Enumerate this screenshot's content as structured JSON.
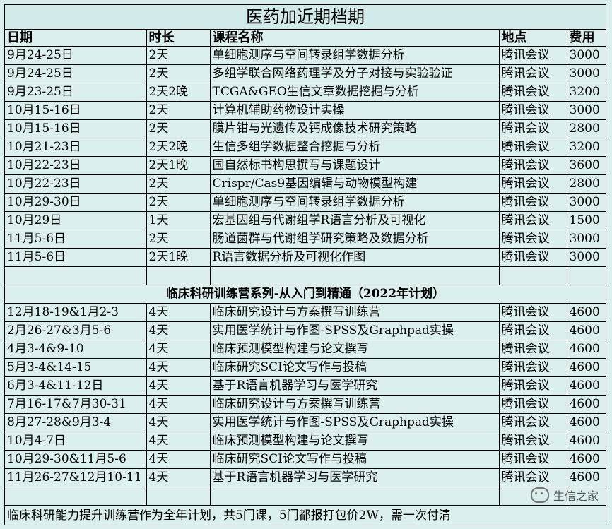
{
  "title": "医药加近期档期",
  "headers": {
    "date": "日期",
    "duration": "时长",
    "course": "课程名称",
    "location": "地点",
    "fee": "费用"
  },
  "courses": [
    {
      "date": "9月24-25日",
      "duration": "2天",
      "course": "单细胞测序与空间转录组学数据分析",
      "location": "腾讯会议",
      "fee": "3000"
    },
    {
      "date": "9月24-25日",
      "duration": "2天",
      "course": "多组学联合网络药理学及分子对接与实验验证",
      "location": "腾讯会议",
      "fee": "3000"
    },
    {
      "date": "9月23-25日",
      "duration": "2天2晚",
      "course": "TCGA&GEO生信文章数据挖掘与分析",
      "location": "腾讯会议",
      "fee": "3200"
    },
    {
      "date": "10月15-16日",
      "duration": "2天",
      "course": "计算机辅助药物设计实操",
      "location": "腾讯会议",
      "fee": "3000"
    },
    {
      "date": "10月15-16日",
      "duration": "2天",
      "course": "膜片钳与光遗传及钙成像技术研究策略",
      "location": "腾讯会议",
      "fee": "2800"
    },
    {
      "date": "10月21-23日",
      "duration": "2天2晚",
      "course": "生信多组学数据整合挖掘与分析",
      "location": "腾讯会议",
      "fee": "3200"
    },
    {
      "date": "10月22-23日",
      "duration": "2天1晚",
      "course": "国自然标书构思撰写与课题设计",
      "location": "腾讯会议",
      "fee": "3600"
    },
    {
      "date": "10月22-23日",
      "duration": "2天",
      "course": "Crispr/Cas9基因编辑与动物模型构建",
      "location": "腾讯会议",
      "fee": "2800"
    },
    {
      "date": "10月29-30日",
      "duration": "2天",
      "course": "单细胞测序与空间转录组学数据分析",
      "location": "腾讯会议",
      "fee": "3000"
    },
    {
      "date": "10月29日",
      "duration": "1天",
      "course": "宏基因组与代谢组学R语言分析及可视化",
      "location": "腾讯会议",
      "fee": "1500"
    },
    {
      "date": "11月5-6日",
      "duration": "2天",
      "course": "肠道菌群与代谢组学研究策略及数据分析",
      "location": "腾讯会议",
      "fee": "3000"
    },
    {
      "date": "11月5-6日",
      "duration": "2天1晚",
      "course": "R语言数据分析及可视化作图",
      "location": "腾讯会议",
      "fee": "3000"
    }
  ],
  "section_title": "临床科研训练营系列-从入门到精通（2022年计划）",
  "camps": [
    {
      "date": "12月18-19&1月2-3",
      "duration": "4天",
      "course": "临床研究设计与方案撰写训练营",
      "location": "腾讯会议",
      "fee": "4600"
    },
    {
      "date": "2月26-27&3月5-6",
      "duration": "4天",
      "course": "实用医学统计与作图-SPSS及Graphpad实操",
      "location": "腾讯会议",
      "fee": "4600"
    },
    {
      "date": "4月3-4&9-10",
      "duration": "4天",
      "course": "临床预测模型构建与论文撰写",
      "location": "腾讯会议",
      "fee": "4600"
    },
    {
      "date": "5月3-4&14-15",
      "duration": "4天",
      "course": "临床研究SCI论文写作与投稿",
      "location": "腾讯会议",
      "fee": "4600"
    },
    {
      "date": "6月3-4&11-12日",
      "duration": "4天",
      "course": "基于R语言机器学习与医学研究",
      "location": "腾讯会议",
      "fee": "4600"
    },
    {
      "date": "7月16-17&7月30-31",
      "duration": "4天",
      "course": "临床研究设计与方案撰写训练营",
      "location": "腾讯会议",
      "fee": "4600"
    },
    {
      "date": "8月27-28&9月3-4",
      "duration": "4天",
      "course": "实用医学统计与作图-SPSS及Graphpad实操",
      "location": "腾讯会议",
      "fee": "4600"
    },
    {
      "date": "10月4-7日",
      "duration": "4天",
      "course": "临床预测模型构建与论文撰写",
      "location": "腾讯会议",
      "fee": "4600"
    },
    {
      "date": "10月29-30&11月5-6",
      "duration": "4天",
      "course": "临床研究SCI论文写作与投稿",
      "location": "腾讯会议",
      "fee": "4600"
    },
    {
      "date": "11月26-27&12月10-11",
      "duration": "4天",
      "course": "基于R语言机器学习与医学研究",
      "location": "腾讯会议",
      "fee": "4600"
    }
  ],
  "footer": "临床科研能力提升训练营作为全年计划，共5门课，5门都报打包价2W，需一次付清",
  "watermark": "生信之家",
  "watermark_icon": "wechat-icon"
}
